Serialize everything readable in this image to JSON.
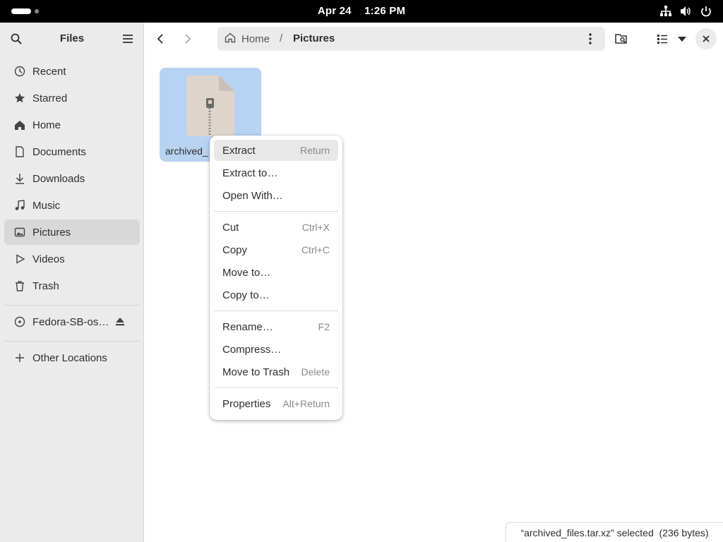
{
  "topbar": {
    "date": "Apr 24",
    "time": "1:26 PM",
    "icons": [
      "activities-indicator",
      "network-icon",
      "volume-icon",
      "power-icon"
    ]
  },
  "sidebar": {
    "title": "Files",
    "items": [
      {
        "label": "Recent",
        "icon": "clock-icon"
      },
      {
        "label": "Starred",
        "icon": "star-icon"
      },
      {
        "label": "Home",
        "icon": "home-icon"
      },
      {
        "label": "Documents",
        "icon": "document-icon"
      },
      {
        "label": "Downloads",
        "icon": "download-icon"
      },
      {
        "label": "Music",
        "icon": "music-icon"
      },
      {
        "label": "Pictures",
        "icon": "picture-icon",
        "active": true
      },
      {
        "label": "Videos",
        "icon": "video-icon"
      },
      {
        "label": "Trash",
        "icon": "trash-icon"
      }
    ],
    "drive": {
      "label": "Fedora-SB-os…",
      "icon": "disc-icon",
      "eject_icon": "eject-icon"
    },
    "other_locations": {
      "label": "Other Locations",
      "icon": "plus-icon"
    }
  },
  "header": {
    "path": {
      "home": "Home",
      "separator": "/",
      "current": "Pictures"
    }
  },
  "files": [
    {
      "name": "archived_files.tar.xz",
      "visible_name": "archived_",
      "selected": true,
      "icon": "archive-file-icon"
    }
  ],
  "context_menu": {
    "items": [
      {
        "label": "Extract",
        "accel": "Return",
        "highlighted": true
      },
      {
        "label": "Extract to…",
        "accel": ""
      },
      {
        "label": "Open With…",
        "accel": ""
      },
      {
        "label": "Cut",
        "accel": "Ctrl+X"
      },
      {
        "label": "Copy",
        "accel": "Ctrl+C"
      },
      {
        "label": "Move to…",
        "accel": ""
      },
      {
        "label": "Copy to…",
        "accel": ""
      },
      {
        "label": "Rename…",
        "accel": "F2"
      },
      {
        "label": "Compress…",
        "accel": ""
      },
      {
        "label": "Move to Trash",
        "accel": "Delete"
      },
      {
        "label": "Properties",
        "accel": "Alt+Return"
      }
    ]
  },
  "status": {
    "text": "“archived_files.tar.xz” selected  (236 bytes)"
  },
  "colors": {
    "selection": "#b8d2f2",
    "sidebar_bg": "#ebebeb",
    "topbar_bg": "#000000"
  }
}
